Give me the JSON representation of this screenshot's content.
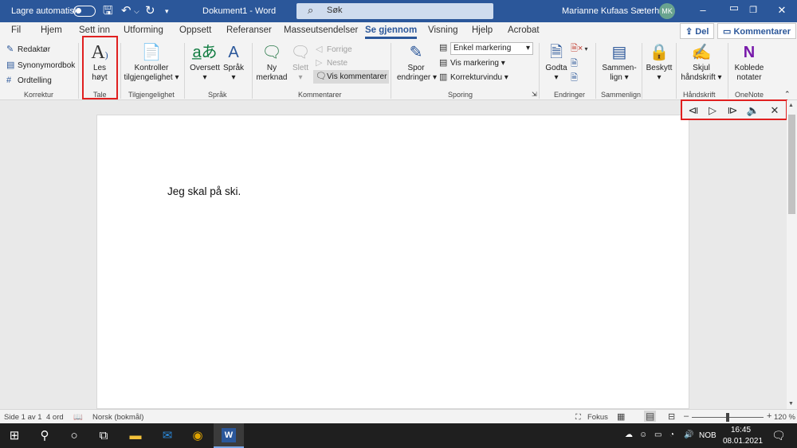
{
  "titlebar": {
    "autosave_label": "Lagre automatisk",
    "doc_title": "Dokument1  -  Word",
    "search_placeholder": "Søk",
    "user_name": "Marianne Kufaas Sæterhaug",
    "user_initials": "MK"
  },
  "menubar": {
    "tabs": [
      "Fil",
      "Hjem",
      "Sett inn",
      "Utforming",
      "Oppsett",
      "Referanser",
      "Masseutsendelser",
      "Se gjennom",
      "Visning",
      "Hjelp",
      "Acrobat"
    ],
    "active_tab": "Se gjennom",
    "share_label": "Del",
    "comments_label": "Kommentarer"
  },
  "ribbon": {
    "korrektur": {
      "items": [
        "Redaktør",
        "Synonymordbok",
        "Ordtelling"
      ],
      "group": "Korrektur"
    },
    "tale": {
      "button_line1": "Les",
      "button_line2": "høyt",
      "group": "Tale"
    },
    "tilgjengelighet": {
      "line1": "Kontroller",
      "line2": "tilgjengelighet",
      "group": "Tilgjengelighet"
    },
    "sprak": {
      "oversett": "Oversett",
      "sprak": "Språk",
      "group": "Språk"
    },
    "kommentarer": {
      "ny_line1": "Ny",
      "ny_line2": "merknad",
      "slett": "Slett",
      "forrige": "Forrige",
      "neste": "Neste",
      "vis": "Vis kommentarer",
      "group": "Kommentarer"
    },
    "sporing": {
      "spor_line1": "Spor",
      "spor_line2": "endringer",
      "markup_select": "Enkel markering",
      "vis_markering": "Vis markering",
      "korrekturvindu": "Korrekturvindu",
      "group": "Sporing"
    },
    "endringer": {
      "godta": "Godta",
      "group": "Endringer"
    },
    "sammenlign": {
      "line1": "Sammen-",
      "line2": "lign",
      "group": "Sammenlign"
    },
    "beskytt": {
      "label": "Beskytt"
    },
    "handskrift": {
      "line1": "Skjul",
      "line2": "håndskrift",
      "group": "Håndskrift"
    },
    "onenote": {
      "line1": "Koblede",
      "line2": "notater",
      "group": "OneNote"
    }
  },
  "document": {
    "text": "Jeg skal på ski."
  },
  "statusbar": {
    "page": "Side 1 av 1",
    "words": "4 ord",
    "language": "Norsk (bokmål)",
    "focus": "Fokus",
    "zoom_minus": "–",
    "zoom_plus": "+",
    "zoom": "120 %",
    "zoom_fraction": 0.5
  },
  "taskbar": {
    "lang": "NOB",
    "time": "16:45",
    "date": "08.01.2021"
  },
  "colors": {
    "word_blue": "#2b579a",
    "highlight_red": "#e02020",
    "taskbar": "#1f1f1f"
  }
}
